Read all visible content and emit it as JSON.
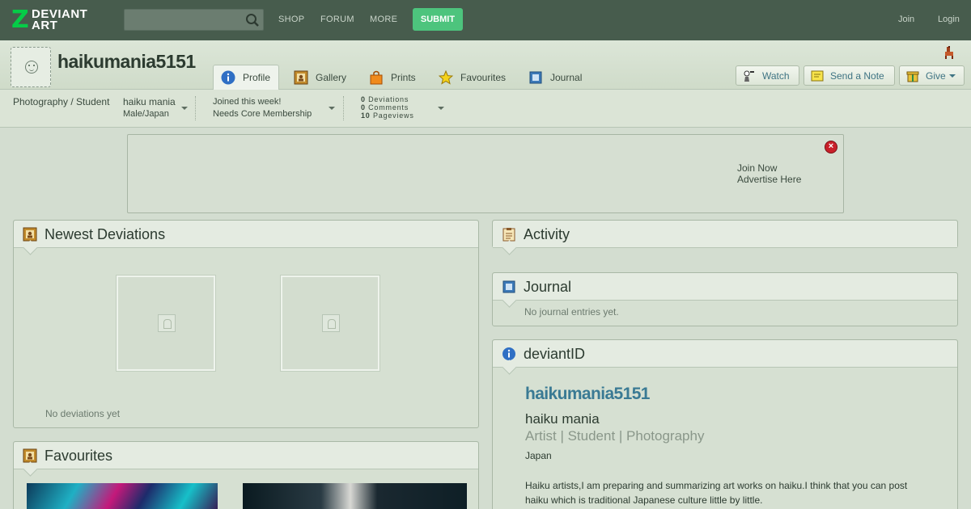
{
  "topbar": {
    "logo_text": "DEVIANT ART",
    "logo_line1": "DEVIANT",
    "logo_line2": "ART",
    "nav": [
      "SHOP",
      "FORUM",
      "MORE"
    ],
    "submit_label": "SUBMIT",
    "join_label": "Join",
    "login_label": "Login",
    "search_placeholder": ""
  },
  "profile": {
    "username": "haikumania5151",
    "tabs": [
      {
        "label": "Profile",
        "icon": "info-icon",
        "active": true
      },
      {
        "label": "Gallery",
        "icon": "gallery-icon"
      },
      {
        "label": "Prints",
        "icon": "prints-icon"
      },
      {
        "label": "Favourites",
        "icon": "star-icon"
      },
      {
        "label": "Journal",
        "icon": "journal-icon"
      }
    ],
    "actions": {
      "watch_label": "Watch",
      "note_label": "Send a Note",
      "give_label": "Give"
    }
  },
  "info": {
    "category": "Photography / Student",
    "name": "haiku mania",
    "demographic": "Male/Japan",
    "joined": "Joined this week!",
    "membership": "Needs Core Membership",
    "stats": [
      {
        "count": "0",
        "label": "Deviations"
      },
      {
        "count": "0",
        "label": "Comments"
      },
      {
        "count": "10",
        "label": "Pageviews"
      }
    ]
  },
  "ad": {
    "line1": "Join Now",
    "line2": "Advertise Here",
    "close_icon": "close-icon"
  },
  "panels": {
    "newest": {
      "title": "Newest Deviations",
      "empty_text": "No deviations yet"
    },
    "favourites": {
      "title": "Favourites"
    },
    "activity": {
      "title": "Activity"
    },
    "journal": {
      "title": "Journal",
      "empty_text": "No journal entries yet."
    },
    "deviantid": {
      "title": "deviantID",
      "username": "haikumania5151",
      "real_name": "haiku mania",
      "tags": "Artist | Student | Photography",
      "country": "Japan",
      "bio": "Haiku artists,I am preparing and summarizing art works on haiku.I think that you can post haiku which is traditional Japanese culture little by little."
    }
  },
  "colors": {
    "topbar": "#475c4d",
    "submit": "#4dc47d",
    "link": "#3a7a94",
    "background": "#d3ddd0"
  }
}
